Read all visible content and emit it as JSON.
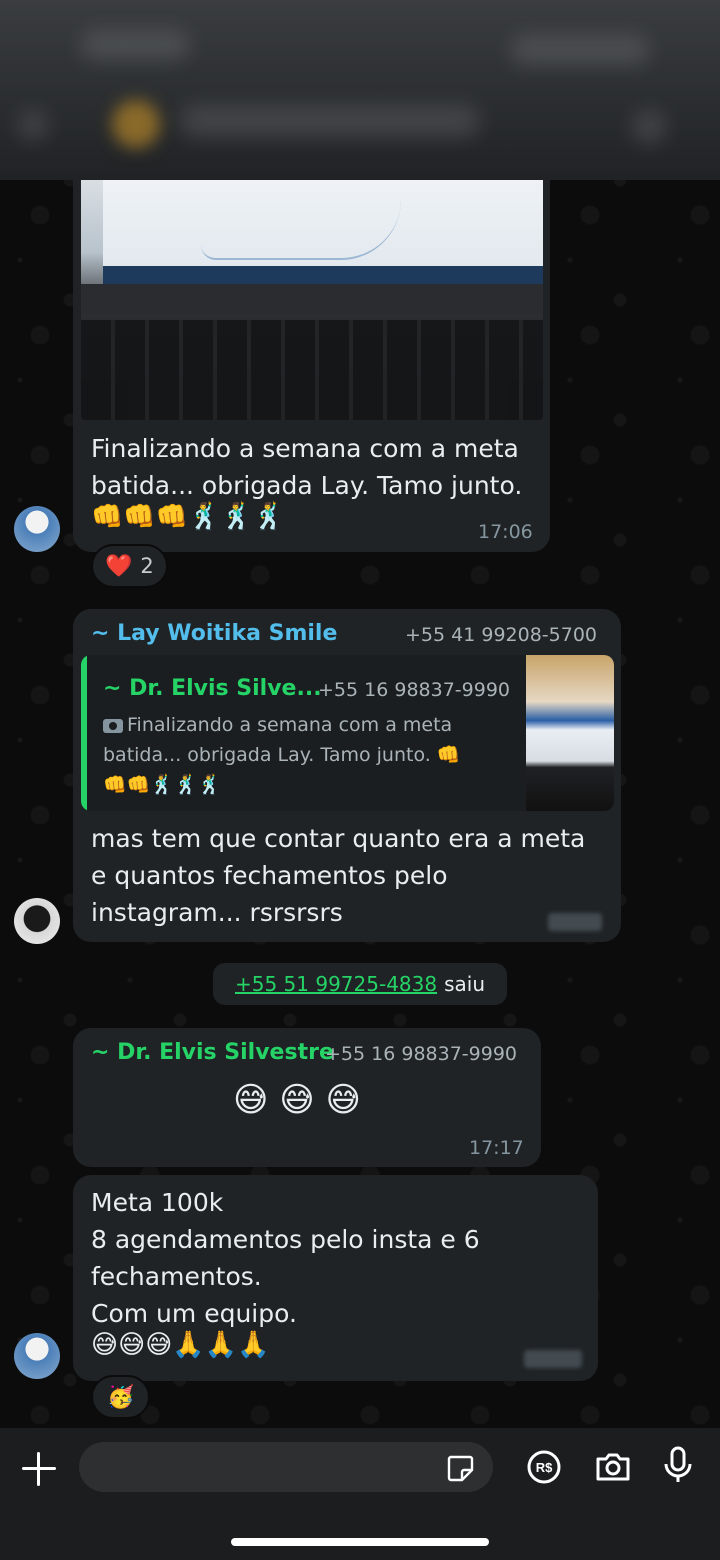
{
  "colors": {
    "bubble": "#202c33",
    "accent_green": "#25d366",
    "sender_blue": "#53bdeb",
    "sender_green": "#25d366"
  },
  "messages": [
    {
      "id": "msg1",
      "text_line1": "Finalizando a semana com a meta",
      "text_line2": "batida... obrigada Lay. Tamo junto.",
      "emojis": "👊👊👊🕺🕺🕺",
      "time": "17:06",
      "reaction": {
        "emoji": "❤️",
        "count": "2"
      }
    },
    {
      "id": "msg2",
      "sender_name": "~ Lay Woitika Smile",
      "sender_phone": "+55 41 99208-5700",
      "quote": {
        "sender_name": "~ Dr. Elvis Silve...",
        "sender_phone": "+55 16 98837-9990",
        "camera_icon": "camera-icon",
        "line1": "Finalizando a semana com a meta",
        "line2": "batida... obrigada Lay. Tamo junto. 👊",
        "line3": "👊👊🕺🕺🕺"
      },
      "text_line1": "mas tem que contar quanto era a meta",
      "text_line2": "e quantos fechamentos pelo",
      "text_line3": "instagram... rsrsrsrs"
    },
    {
      "id": "msg3",
      "sender_name": "~ Dr. Elvis Silvestre",
      "sender_phone": "+55 16 98837-9990",
      "emojis": "😅 😅 😅",
      "time": "17:17"
    },
    {
      "id": "msg4",
      "line1": "Meta 100k",
      "line2": "8 agendamentos pelo insta e 6",
      "line3": "fechamentos.",
      "line4": "Com um equipo.",
      "emojis": "😅😅😅🙏🙏🙏",
      "reaction": {
        "emoji": "🥳"
      }
    }
  ],
  "system_message": {
    "phone": "+55 51 99725-4838",
    "action": "saiu"
  },
  "footer": {
    "icons": [
      "plus-icon",
      "sticker-icon",
      "payment-icon",
      "camera-icon",
      "microphone-icon"
    ],
    "payment_label": "R$"
  }
}
